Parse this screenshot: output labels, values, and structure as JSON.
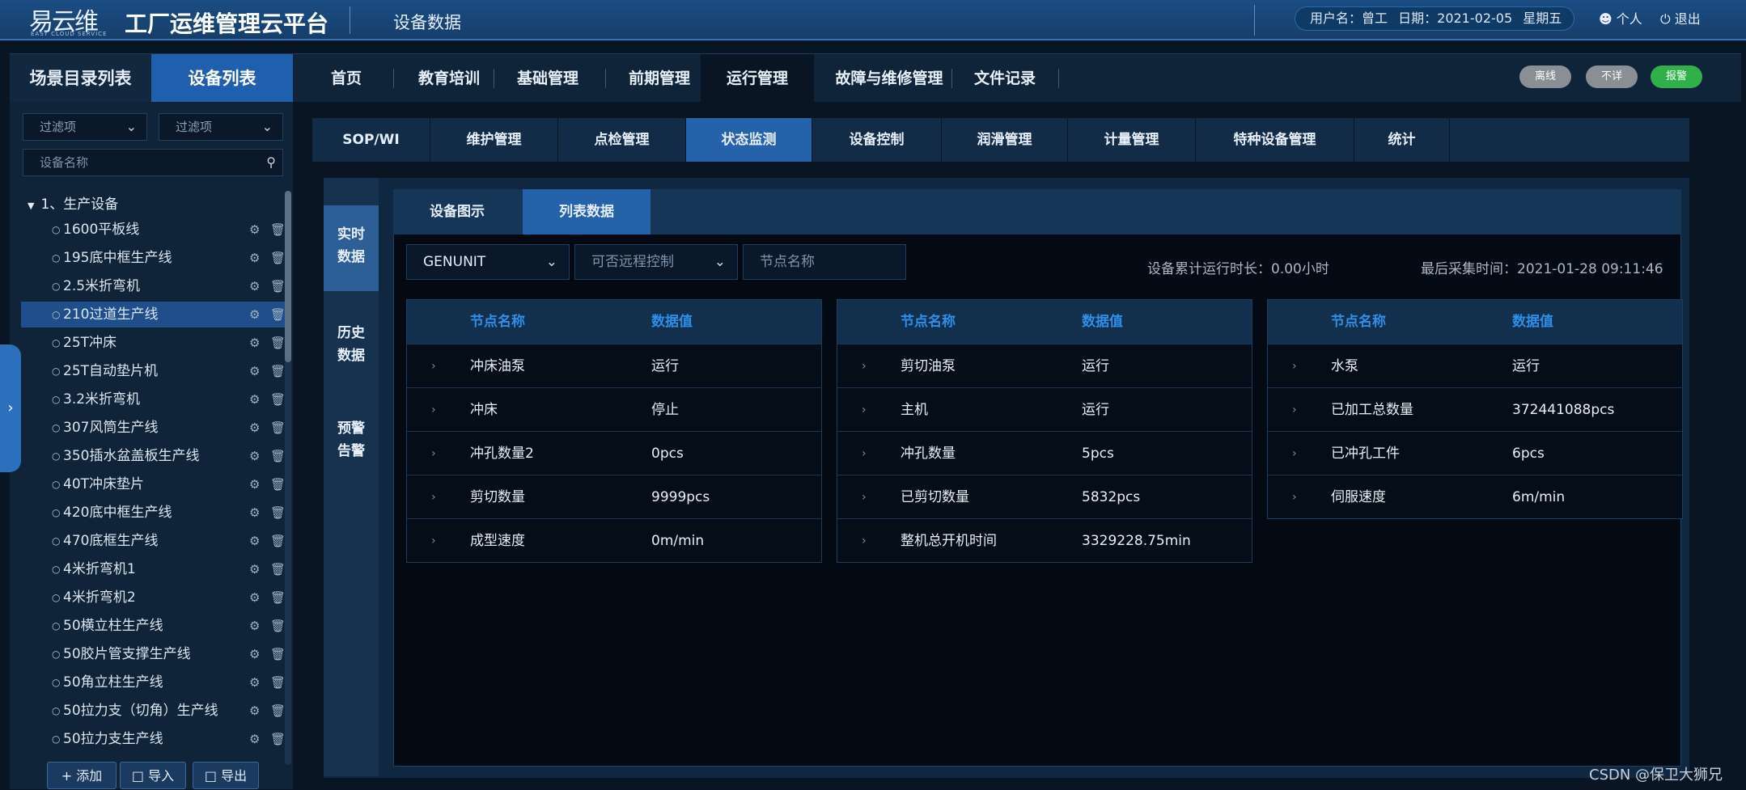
{
  "header": {
    "logo_text": "易云维",
    "logo_sub": "EASY CLOUD SERVICE",
    "app_title": "工厂运维管理云平台",
    "page_title": "设备数据",
    "user_label": "用户名：",
    "user_name": "曾工",
    "date_label": "日期：",
    "date_value": "2021-02-05",
    "weekday": "星期五",
    "personal": "个人",
    "logout": "退出"
  },
  "left_tabs": {
    "scene": "场景目录列表",
    "devices": "设备列表"
  },
  "main_nav": [
    "首页",
    "教育培训",
    "基础管理",
    "前期管理",
    "运行管理",
    "故障与维修管理",
    "文件记录"
  ],
  "status_pills": [
    {
      "label": "离线",
      "color": "#8a8f96"
    },
    {
      "label": "不详",
      "color": "#8a8f96"
    },
    {
      "label": "报警",
      "color": "#2fb04a"
    }
  ],
  "filters": {
    "filter1": "过滤项",
    "filter2": "过滤项",
    "device_name_placeholder": "设备名称"
  },
  "tree": {
    "root": "1、生产设备",
    "items": [
      "1600平板线",
      "195底中框生产线",
      "2.5米折弯机",
      "210过道生产线",
      "25T冲床",
      "25T自动垫片机",
      "3.2米折弯机",
      "307风筒生产线",
      "350插水盆盖板生产线",
      "40T冲床垫片",
      "420底中框生产线",
      "470底框生产线",
      "4米折弯机1",
      "4米折弯机2",
      "50横立柱生产线",
      "50胶片管支撑生产线",
      "50角立柱生产线",
      "50拉力支（切角）生产线",
      "50拉力支生产线"
    ],
    "selected": "210过道生产线"
  },
  "bottom_buttons": {
    "add": "添加",
    "import": "导入",
    "export": "导出"
  },
  "sub_nav": [
    "SOP/WI",
    "维护管理",
    "点检管理",
    "状态监测",
    "设备控制",
    "润滑管理",
    "计量管理",
    "特种设备管理",
    "统计"
  ],
  "vertical_tabs": [
    {
      "line1": "实时",
      "line2": "数据"
    },
    {
      "line1": "历史",
      "line2": "数据"
    },
    {
      "line1": "预警",
      "line2": "告警"
    }
  ],
  "inner_tabs": [
    "设备图示",
    "列表数据"
  ],
  "controls": {
    "unit_select": "GENUNIT",
    "remote_select": "可否远程控制",
    "node_placeholder": "节点名称",
    "runtime": "设备累计运行时长：0.00小时",
    "last_collect": "最后采集时间：2021-01-28 09:11:46"
  },
  "table_headers": {
    "name": "节点名称",
    "value": "数据值"
  },
  "tables": [
    [
      {
        "name": "冲床油泵",
        "value": "运行"
      },
      {
        "name": "冲床",
        "value": "停止"
      },
      {
        "name": "冲孔数量2",
        "value": "0pcs"
      },
      {
        "name": "剪切数量",
        "value": "9999pcs"
      },
      {
        "name": "成型速度",
        "value": "0m/min"
      }
    ],
    [
      {
        "name": "剪切油泵",
        "value": "运行"
      },
      {
        "name": "主机",
        "value": "运行"
      },
      {
        "name": "冲孔数量",
        "value": "5pcs"
      },
      {
        "name": "已剪切数量",
        "value": "5832pcs"
      },
      {
        "name": "整机总开机时间",
        "value": "3329228.75min"
      }
    ],
    [
      {
        "name": "水泵",
        "value": "运行"
      },
      {
        "name": "已加工总数量",
        "value": "372441088pcs"
      },
      {
        "name": "已冲孔工件",
        "value": "6pcs"
      },
      {
        "name": "伺服速度",
        "value": "6m/min"
      }
    ]
  ],
  "watermark": "CSDN @保卫大狮兄"
}
